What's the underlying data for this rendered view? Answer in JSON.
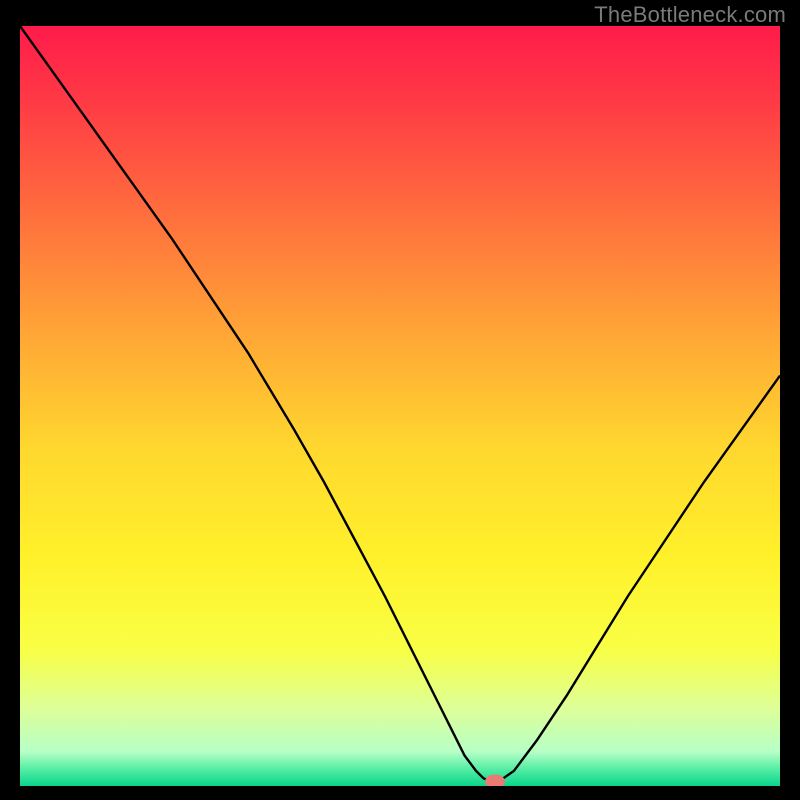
{
  "watermark": "TheBottleneck.com",
  "chart_data": {
    "type": "line",
    "title": "",
    "xlabel": "",
    "ylabel": "",
    "xlim": [
      0,
      100
    ],
    "ylim": [
      0,
      100
    ],
    "grid": false,
    "legend": false,
    "background_gradient": {
      "stops": [
        {
          "offset": 0.0,
          "color": "#ff1b4a"
        },
        {
          "offset": 0.1,
          "color": "#ff3a45"
        },
        {
          "offset": 0.25,
          "color": "#ff6f3d"
        },
        {
          "offset": 0.4,
          "color": "#ffa436"
        },
        {
          "offset": 0.55,
          "color": "#ffd62f"
        },
        {
          "offset": 0.7,
          "color": "#fff12a"
        },
        {
          "offset": 0.82,
          "color": "#f9ff45"
        },
        {
          "offset": 0.9,
          "color": "#dcff9a"
        },
        {
          "offset": 0.955,
          "color": "#b6ffc6"
        },
        {
          "offset": 0.975,
          "color": "#60f0a8"
        },
        {
          "offset": 1.0,
          "color": "#08d68a"
        }
      ]
    },
    "series": [
      {
        "name": "bottleneck-curve",
        "color": "#000000",
        "width": 2.4,
        "x": [
          0,
          5,
          10,
          15,
          20,
          25,
          30,
          33,
          36,
          40,
          44,
          48,
          52,
          55,
          57,
          58.5,
          60,
          61,
          62,
          63,
          65,
          68,
          72,
          76,
          80,
          85,
          90,
          95,
          100
        ],
        "y": [
          100,
          93,
          86,
          79,
          72,
          64.5,
          57,
          52,
          47,
          40,
          32.5,
          25,
          17,
          11,
          7,
          4,
          2,
          1,
          0.6,
          0.6,
          2,
          6,
          12,
          18.5,
          25,
          32.5,
          40,
          47,
          54
        ]
      }
    ],
    "marker": {
      "name": "optimal-point",
      "x": 62.5,
      "y": 0.6,
      "color": "#e97a74",
      "rx": 10,
      "ry": 7
    }
  }
}
